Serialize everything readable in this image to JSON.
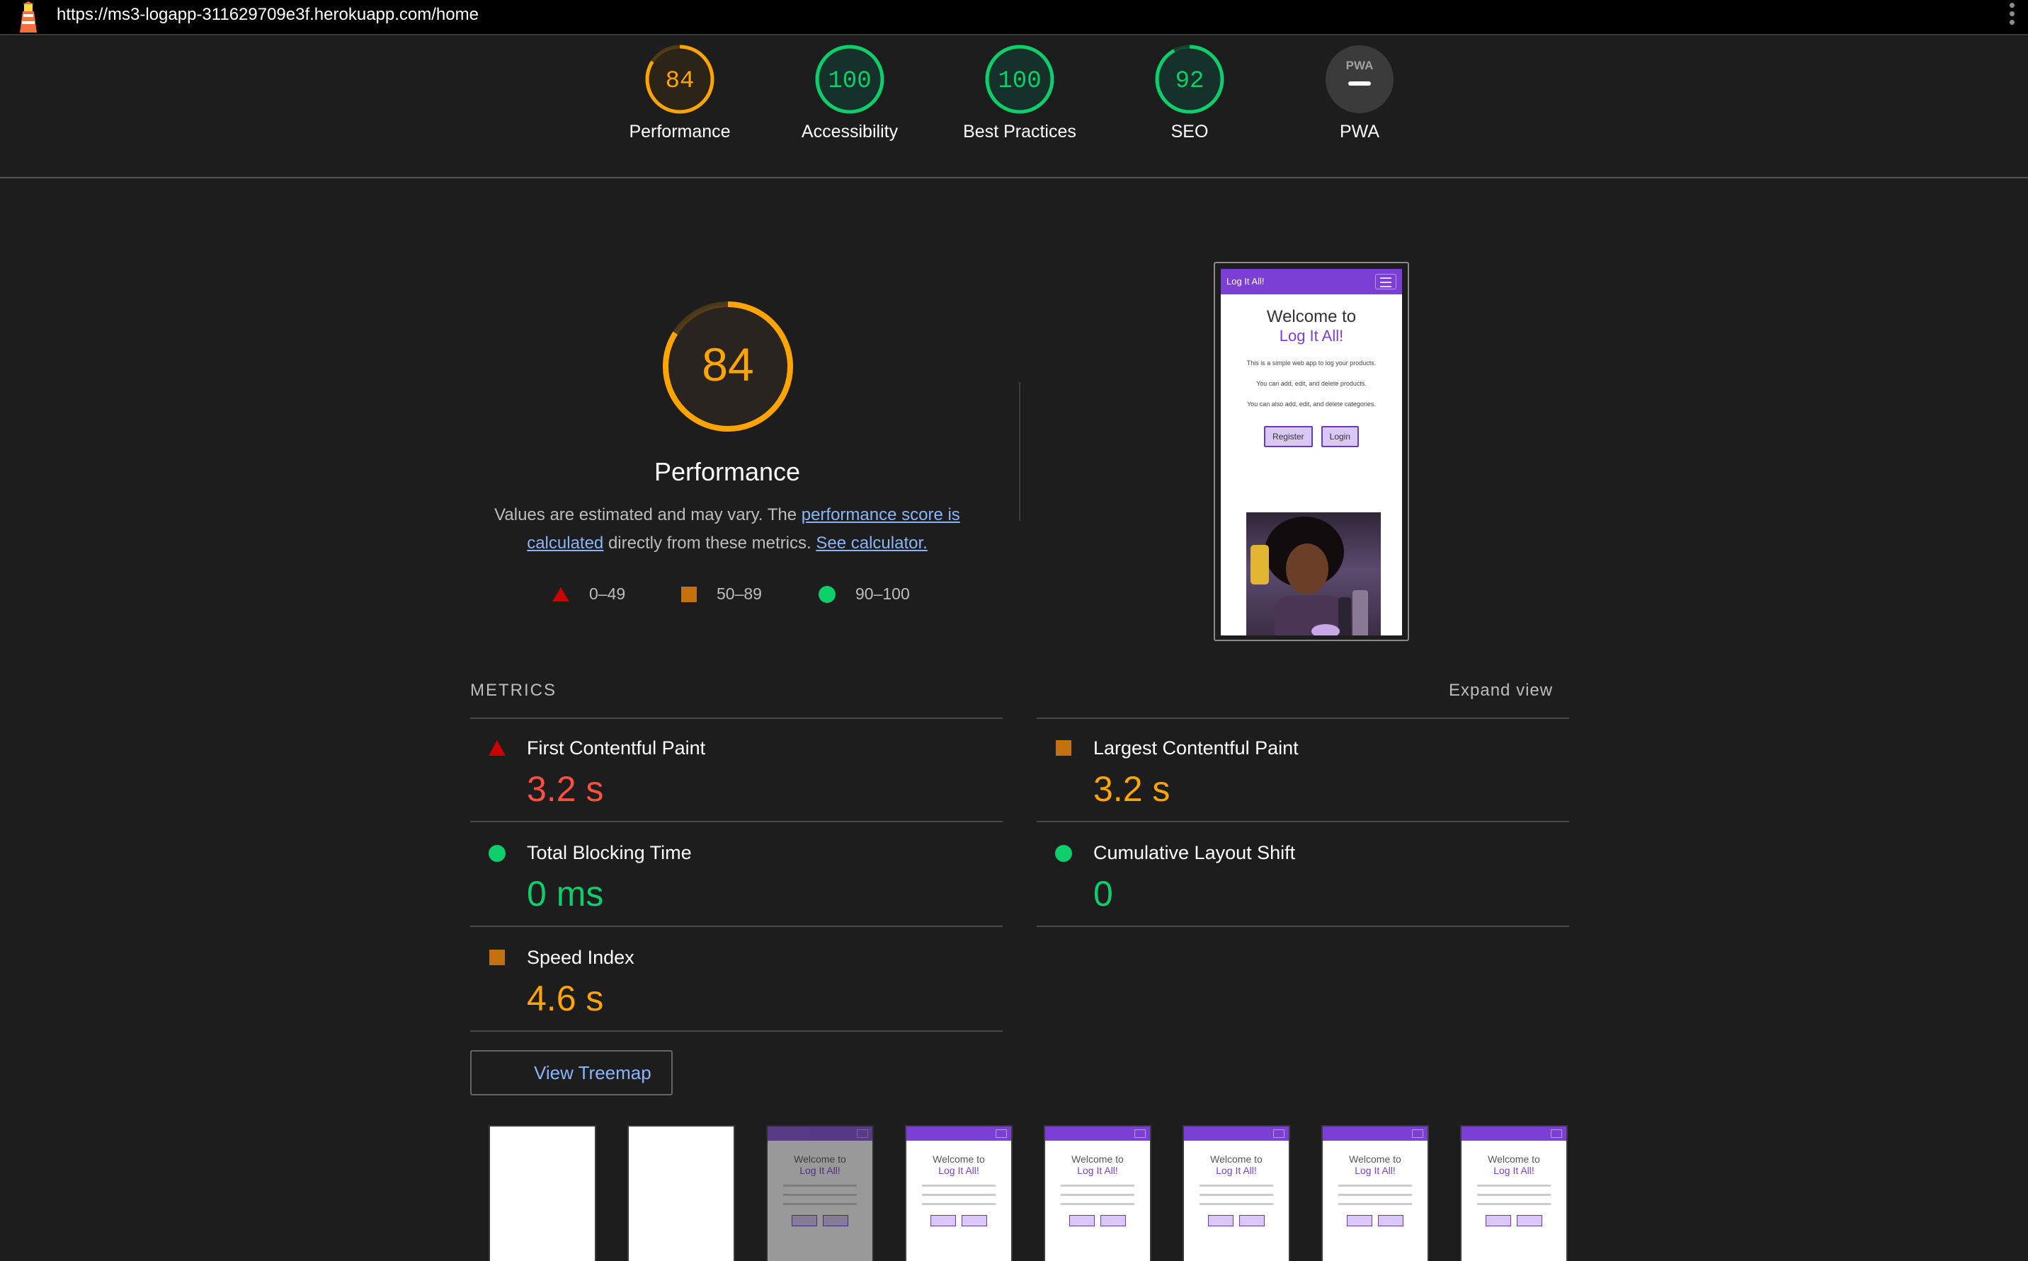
{
  "browser": {
    "url": "https://ms3-logapp-311629709e3f.herokuapp.com/home"
  },
  "colors": {
    "pass": "#0cce6b",
    "average": "#ffa400",
    "fail": "#ff4e42",
    "link": "#8ab4f8",
    "background": "#1d1d1e"
  },
  "categories": [
    {
      "label": "Performance",
      "score": "84",
      "status": "average"
    },
    {
      "label": "Accessibility",
      "score": "100",
      "status": "pass"
    },
    {
      "label": "Best Practices",
      "score": "100",
      "status": "pass"
    },
    {
      "label": "SEO",
      "score": "92",
      "status": "pass"
    },
    {
      "label": "PWA",
      "score": "PWA",
      "status": "na"
    }
  ],
  "performance": {
    "score": "84",
    "title": "Performance",
    "desc_prefix": "Values are estimated and may vary. The ",
    "desc_link1": "performance score is calculated",
    "desc_middle": " directly from these metrics. ",
    "desc_link2": "See calculator.",
    "legend": [
      {
        "shape": "triangle",
        "range": "0–49"
      },
      {
        "shape": "square",
        "range": "50–89"
      },
      {
        "shape": "circle",
        "range": "90–100"
      }
    ]
  },
  "screenshot": {
    "nav_title": "Log It All!",
    "heading_line1": "Welcome to",
    "heading_line2": "Log It All!",
    "para1": "This is a simple web app to log your products.",
    "para2": "You can add, edit, and delete products.",
    "para3": "You can also add, edit, and delete categories.",
    "btn_register": "Register",
    "btn_login": "Login"
  },
  "metrics": {
    "heading": "METRICS",
    "expand_label": "Expand view",
    "items": [
      {
        "name": "First Contentful Paint",
        "value": "3.2 s",
        "status": "fail"
      },
      {
        "name": "Largest Contentful Paint",
        "value": "3.2 s",
        "status": "average"
      },
      {
        "name": "Total Blocking Time",
        "value": "0 ms",
        "status": "pass"
      },
      {
        "name": "Cumulative Layout Shift",
        "value": "0",
        "status": "pass"
      },
      {
        "name": "Speed Index",
        "value": "4.6 s",
        "status": "average"
      }
    ]
  },
  "treemap_button": "View Treemap",
  "filmstrip": {
    "frame_heading_line1": "Welcome to",
    "frame_heading_line2": "Log It All!"
  }
}
